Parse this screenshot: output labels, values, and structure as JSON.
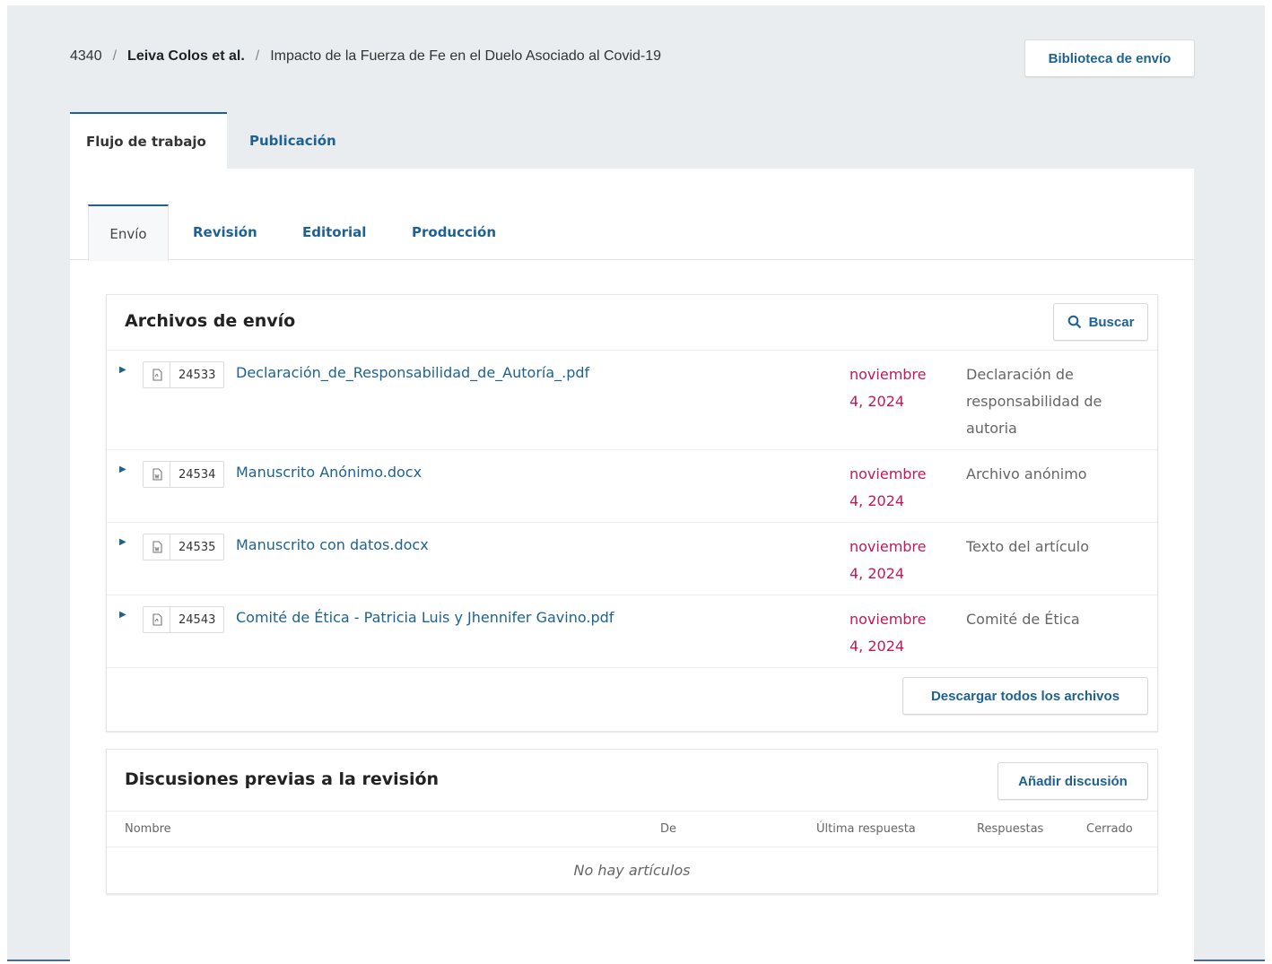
{
  "breadcrumb": {
    "id": "4340",
    "authors": "Leiva Colos et al.",
    "title": "Impacto de la Fuerza de Fe en el Duelo Asociado al Covid-19"
  },
  "header": {
    "library_button": "Biblioteca de envío"
  },
  "main_tabs": [
    {
      "label": "Flujo de trabajo",
      "active": true
    },
    {
      "label": "Publicación",
      "active": false
    }
  ],
  "stage_tabs": [
    {
      "label": "Envío",
      "active": true
    },
    {
      "label": "Revisión",
      "active": false
    },
    {
      "label": "Editorial",
      "active": false
    },
    {
      "label": "Producción",
      "active": false
    }
  ],
  "files_card": {
    "title": "Archivos de envío",
    "search_button": "Buscar",
    "download_all_button": "Descargar todos los archivos",
    "files": [
      {
        "icon": "pdf-file-icon",
        "id": "24533",
        "name": "Declaración_de_Responsabilidad_de_Autoría_.pdf",
        "date_line1": "noviembre",
        "date_line2": "4, 2024",
        "type_lines": [
          "Declaración de",
          "responsabilidad de",
          "autoria"
        ]
      },
      {
        "icon": "word-file-icon",
        "id": "24534",
        "name": "Manuscrito Anónimo.docx",
        "date_line1": "noviembre",
        "date_line2": "4, 2024",
        "type_lines": [
          "Archivo anónimo"
        ]
      },
      {
        "icon": "word-file-icon",
        "id": "24535",
        "name": "Manuscrito con datos.docx",
        "date_line1": "noviembre",
        "date_line2": "4, 2024",
        "type_lines": [
          "Texto del artículo"
        ]
      },
      {
        "icon": "pdf-file-icon",
        "id": "24543",
        "name": "Comité de Ética - Patricia Luis y Jhennifer Gavino.pdf",
        "date_line1": "noviembre",
        "date_line2": "4, 2024",
        "type_lines": [
          "Comité de Ética"
        ]
      }
    ]
  },
  "discussions_card": {
    "title": "Discusiones previas a la revisión",
    "add_button": "Añadir discusión",
    "columns": [
      "Nombre",
      "De",
      "Última respuesta",
      "Respuestas",
      "Cerrado"
    ],
    "empty_message": "No hay artículos"
  },
  "colors": {
    "link": "#1e6292",
    "date": "#c0185a",
    "page_bg": "#eaedef"
  }
}
